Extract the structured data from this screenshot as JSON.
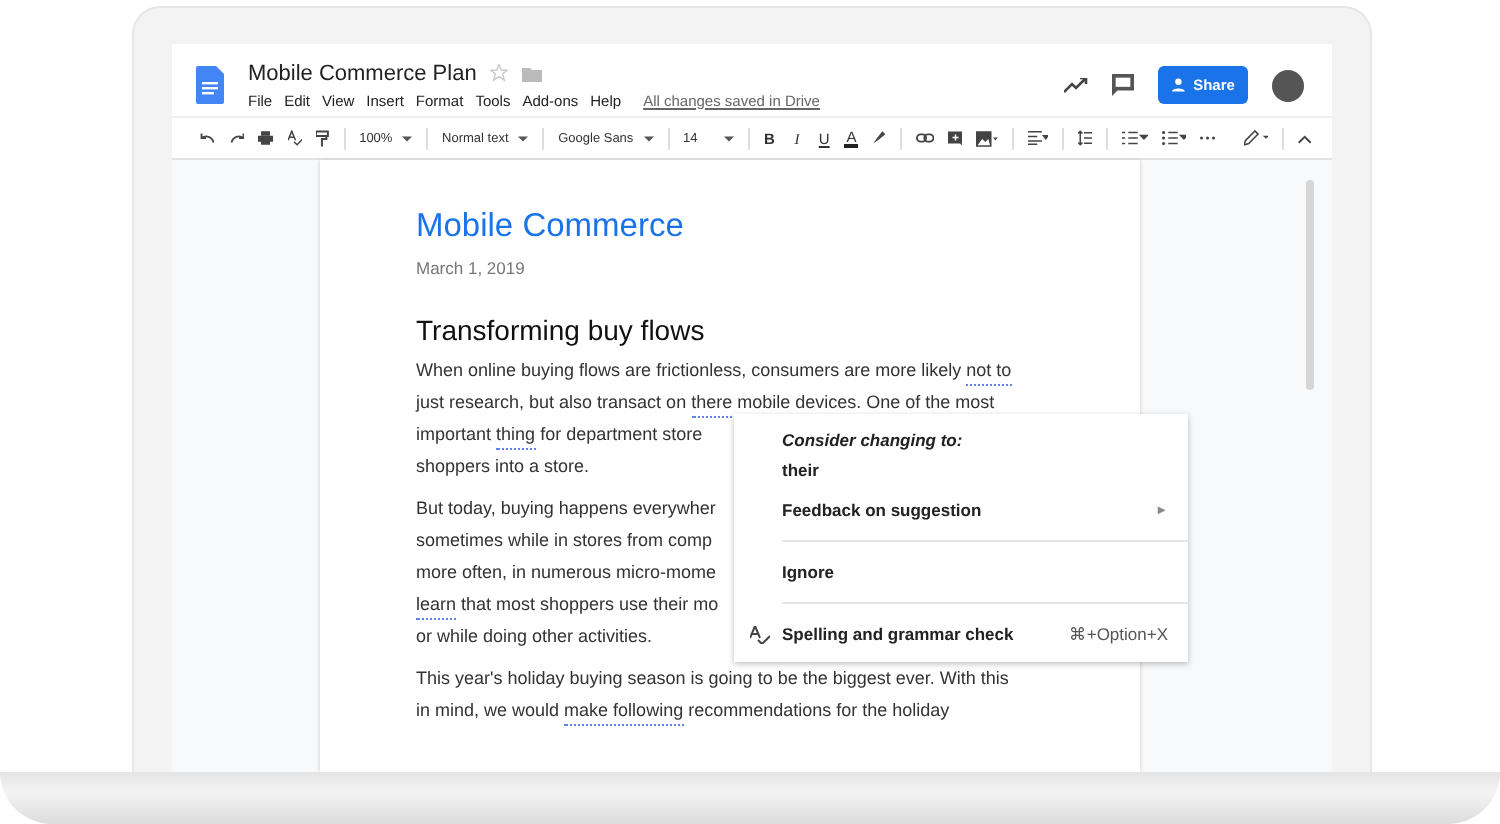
{
  "document": {
    "title": "Mobile Commerce Plan",
    "starred": false
  },
  "menu": [
    "File",
    "Edit",
    "View",
    "Insert",
    "Format",
    "Tools",
    "Add-ons",
    "Help"
  ],
  "save_status": "All changes saved in Drive",
  "share_button": "Share",
  "toolbar": {
    "zoom": "100%",
    "style": "Normal text",
    "font": "Google Sans",
    "size": "14",
    "format_buttons": [
      {
        "kind": "bold",
        "label": "B"
      },
      {
        "kind": "italic",
        "label": "I"
      },
      {
        "kind": "underline",
        "label": "U"
      },
      {
        "kind": "color",
        "label": "A"
      }
    ]
  },
  "page": {
    "title": "Mobile Commerce",
    "date": "March 1, 2019",
    "heading": "Transforming buy flows",
    "paragraphs": [
      [
        [
          {
            "text": "When online buying flows are frictionless, consumers are more likely "
          },
          {
            "text": "not to",
            "flagged": true
          }
        ],
        [
          {
            "text": "just research, but also transact on "
          },
          {
            "text": "there",
            "flagged": true
          },
          {
            "text": " mobile devices. One of the most"
          }
        ],
        [
          {
            "text": "important "
          },
          {
            "text": "thing",
            "flagged": true
          },
          {
            "text": " for department store"
          }
        ],
        [
          {
            "text": "shoppers into a store."
          }
        ]
      ],
      [
        [
          {
            "text": "But today, buying happens everywher"
          }
        ],
        [
          {
            "text": "sometimes while in stores from comp"
          }
        ],
        [
          {
            "text": "more often, in numerous micro-mome"
          }
        ],
        [
          {
            "text": "learn",
            "flagged": true
          },
          {
            "text": " that most shoppers use their mo"
          }
        ],
        [
          {
            "text": "or while doing other activities."
          }
        ]
      ],
      [
        [
          {
            "text": "This year's holiday buying season is going to be the biggest ever. With this"
          }
        ],
        [
          {
            "text": "in mind, we would "
          },
          {
            "text": "make following",
            "flagged": true
          },
          {
            "text": " recommendations for the holiday"
          }
        ]
      ]
    ]
  },
  "suggestion_menu": {
    "heading": "Consider changing to:",
    "items": [
      {
        "kind": "suggestion",
        "label": "their"
      },
      {
        "kind": "submenu",
        "label": "Feedback on suggestion",
        "arrow": "▸"
      },
      {
        "kind": "divider"
      },
      {
        "kind": "plain",
        "label": "Ignore"
      },
      {
        "kind": "divider"
      },
      {
        "kind": "command",
        "label": "Spelling and grammar check",
        "shortcut": "⌘+Option+X"
      }
    ]
  }
}
